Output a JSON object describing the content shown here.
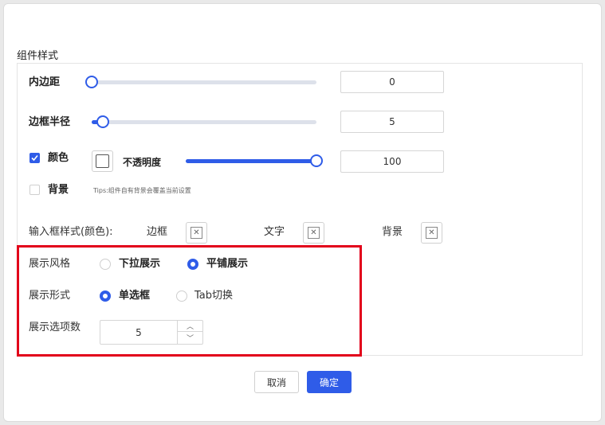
{
  "section_title": "组件样式",
  "style": {
    "padding": {
      "label": "内边距",
      "value": "0",
      "slider_fraction": 0.0
    },
    "radius": {
      "label": "边框半径",
      "value": "5",
      "slider_fraction": 0.05
    },
    "color": {
      "label": "颜色",
      "checked": true,
      "opacity_label": "不透明度",
      "opacity_value": "100",
      "opacity_fraction": 1.0
    },
    "background": {
      "label": "背景",
      "checked": false,
      "tips": "Tips:组件自有背景会覆盖当前设置"
    },
    "input_colors": {
      "label": "输入框样式(颜色):",
      "border": "边框",
      "text": "文字",
      "bg": "背景"
    }
  },
  "display": {
    "style_label": "展示风格",
    "style_options": [
      "下拉展示",
      "平铺展示"
    ],
    "style_selected": "平铺展示",
    "form_label": "展示形式",
    "form_options": [
      "单选框",
      "Tab切换"
    ],
    "form_selected": "单选框",
    "count_label": "展示选项数",
    "count_value": "5"
  },
  "footer": {
    "cancel": "取消",
    "ok": "确定"
  },
  "colors": {
    "accent": "#2f5ce8",
    "highlight": "#e2001a"
  }
}
